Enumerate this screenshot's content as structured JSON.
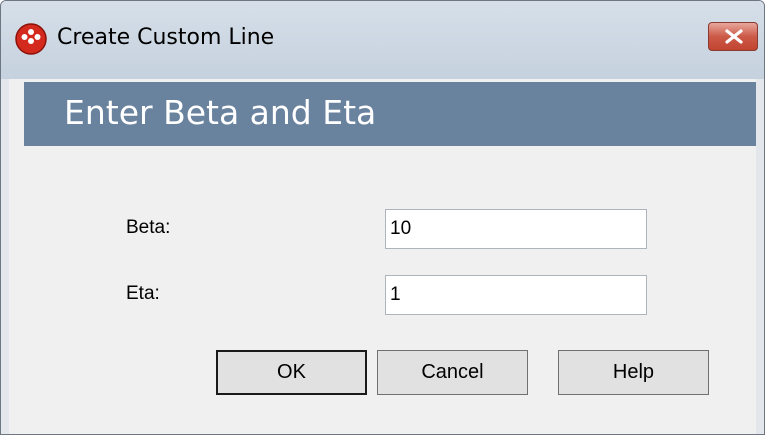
{
  "window": {
    "title": "Create Custom Line"
  },
  "banner": {
    "title": "Enter Beta and Eta"
  },
  "fields": {
    "beta": {
      "label": "Beta:",
      "value": "10"
    },
    "eta": {
      "label": "Eta:",
      "value": "1"
    }
  },
  "buttons": {
    "ok": "OK",
    "cancel": "Cancel",
    "help": "Help"
  },
  "colors": {
    "banner": "#69829e",
    "client_background": "#f0f0f0",
    "close_button": "#c9503c"
  },
  "icons": {
    "app": "red-circle-app-icon",
    "close": "close-icon"
  }
}
